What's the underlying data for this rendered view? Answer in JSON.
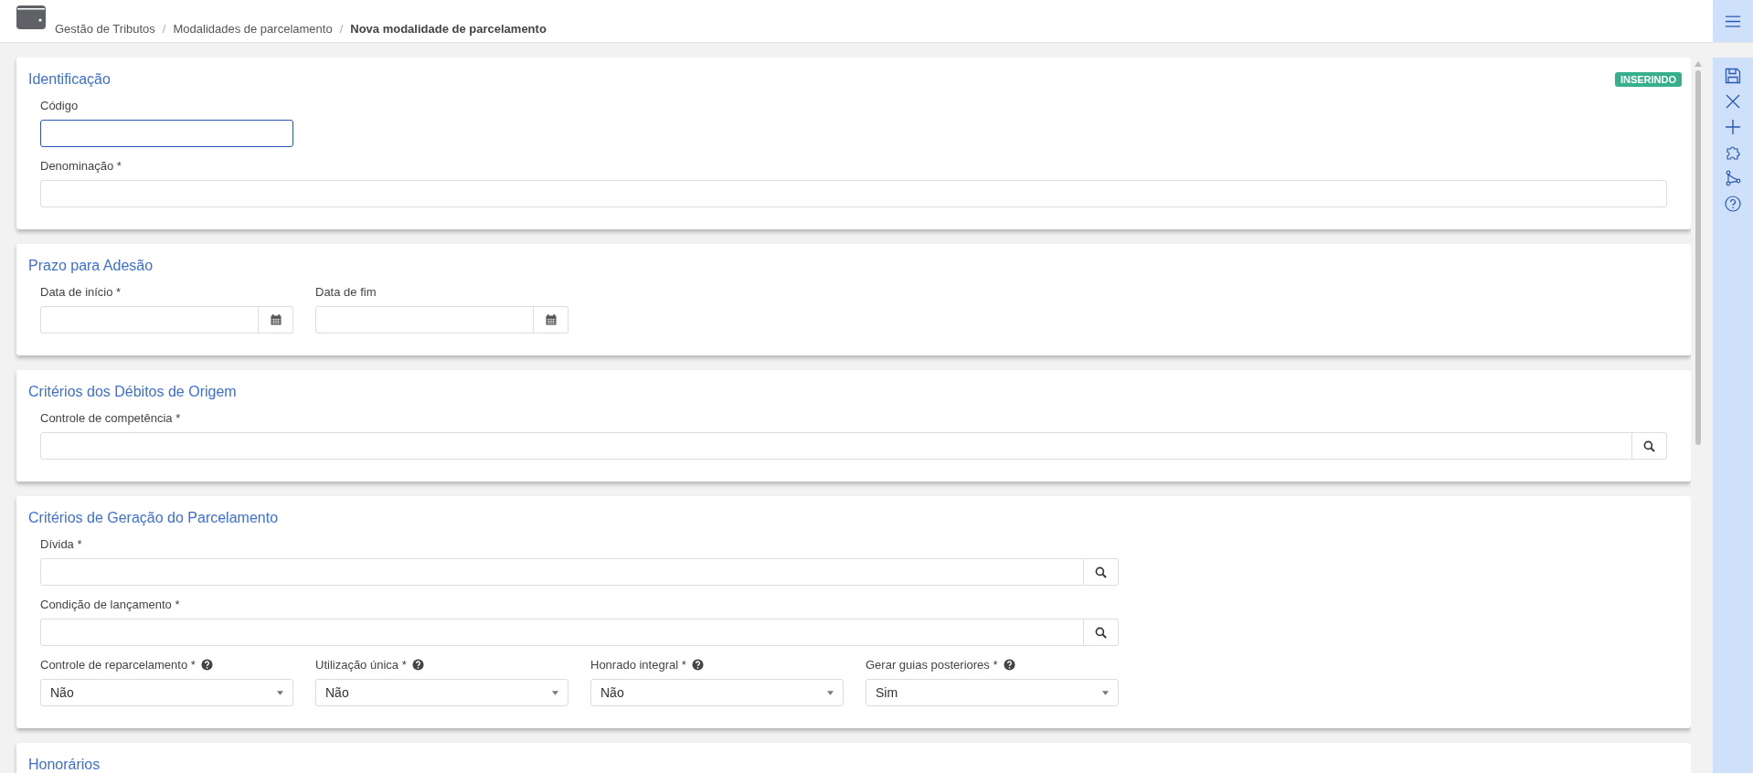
{
  "breadcrumbs": [
    {
      "label": "Gestão de Tributos",
      "current": false
    },
    {
      "label": "Modalidades de parcelamento",
      "current": false
    },
    {
      "label": "Nova modalidade de parcelamento",
      "current": true
    }
  ],
  "breadcrumb_separator": "/",
  "status_badge": "INSERINDO",
  "sections": [
    {
      "title": "Identificação",
      "rows": [
        [
          {
            "label": "Código",
            "kind": "text",
            "focused": true
          }
        ],
        [
          {
            "label": "Denominação *",
            "kind": "text",
            "focused": false
          }
        ]
      ]
    },
    {
      "title": "Prazo para Adesão",
      "rows": [
        [
          {
            "label": "Data de início *",
            "kind": "date",
            "focused": false
          },
          {
            "label": "Data de fim",
            "kind": "date",
            "focused": false
          }
        ]
      ]
    },
    {
      "title": "Critérios dos Débitos de Origem",
      "rows": [
        [
          {
            "label": "Controle de competência *",
            "kind": "search",
            "focused": false
          }
        ]
      ]
    },
    {
      "title": "Critérios de Geração do Parcelamento",
      "rows": [
        [
          {
            "label": "Dívida *",
            "kind": "search",
            "focused": false
          }
        ],
        [
          {
            "label": "Condição de lançamento *",
            "kind": "search",
            "focused": false
          }
        ],
        [
          {
            "label": "Controle de reparcelamento *",
            "kind": "select",
            "focused": false,
            "help": true,
            "value": "Não"
          },
          {
            "label": "Utilização única *",
            "kind": "select",
            "focused": false,
            "help": true,
            "value": "Não"
          },
          {
            "label": "Honrado integral *",
            "kind": "select",
            "focused": false,
            "help": true,
            "value": "Não"
          },
          {
            "label": "Gerar guias posteriores *",
            "kind": "select",
            "focused": false,
            "help": true,
            "value": "Sim"
          }
        ]
      ]
    },
    {
      "title": "Honorários"
    }
  ],
  "toolbar": [
    {
      "kind": "save"
    },
    {
      "kind": "close"
    },
    {
      "kind": "add"
    },
    {
      "kind": "puzzle"
    },
    {
      "kind": "branch"
    },
    {
      "kind": "help"
    }
  ]
}
